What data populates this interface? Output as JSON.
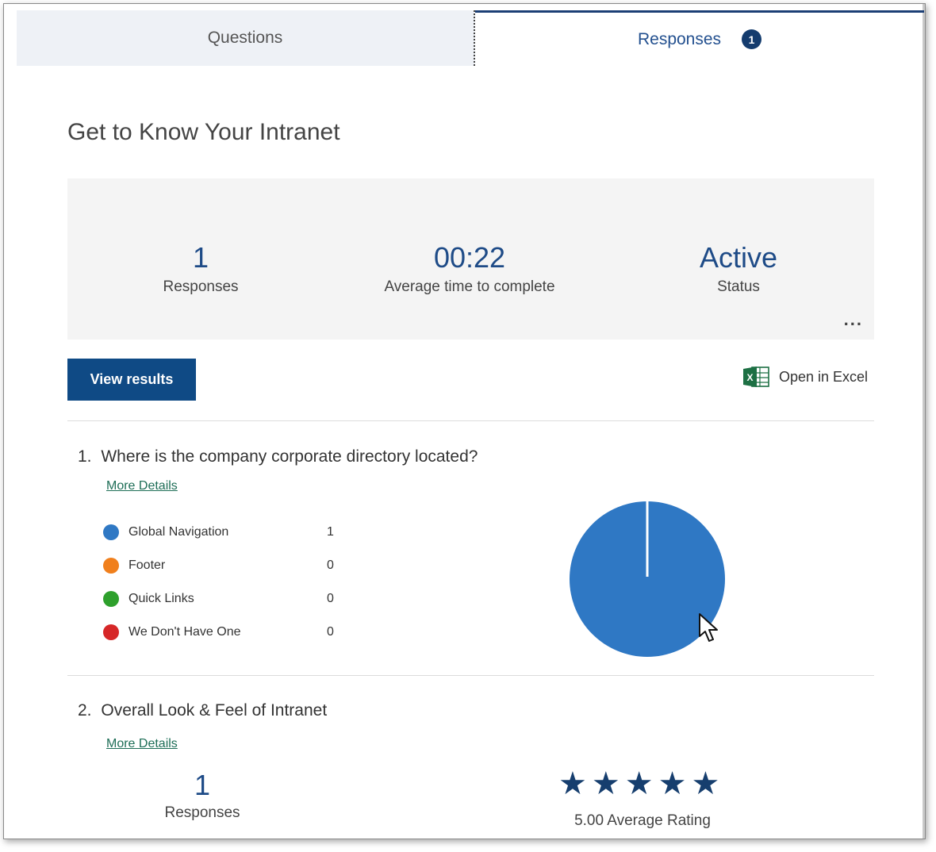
{
  "tabs": {
    "questions_label": "Questions",
    "responses_label": "Responses",
    "responses_badge": "1"
  },
  "form": {
    "title": "Get to Know Your Intranet"
  },
  "summary": {
    "responses_value": "1",
    "responses_label": "Responses",
    "avg_time_value": "00:22",
    "avg_time_label": "Average time to complete",
    "status_value": "Active",
    "status_label": "Status",
    "more_label": "..."
  },
  "actions": {
    "view_results_label": "View results",
    "open_excel_label": "Open in Excel"
  },
  "questions": [
    {
      "number": "1.",
      "title": "Where is the company corporate directory located?",
      "more_details": "More Details",
      "options": [
        {
          "label": "Global Navigation",
          "count": "1",
          "color": "#2f78c4"
        },
        {
          "label": "Footer",
          "count": "0",
          "color": "#f07f1c"
        },
        {
          "label": "Quick Links",
          "count": "0",
          "color": "#2ea02c"
        },
        {
          "label": "We Don't Have One",
          "count": "0",
          "color": "#d62728"
        }
      ]
    },
    {
      "number": "2.",
      "title": "Overall Look & Feel of Intranet",
      "more_details": "More Details",
      "responses_value": "1",
      "responses_label": "Responses",
      "rating_stars": 5,
      "average_rating_label": "5.00 Average Rating"
    }
  ],
  "chart_data": {
    "type": "pie",
    "categories": [
      "Global Navigation",
      "Footer",
      "Quick Links",
      "We Don't Have One"
    ],
    "values": [
      1,
      0,
      0,
      0
    ],
    "colors": [
      "#2f78c4",
      "#f07f1c",
      "#2ea02c",
      "#d62728"
    ]
  }
}
